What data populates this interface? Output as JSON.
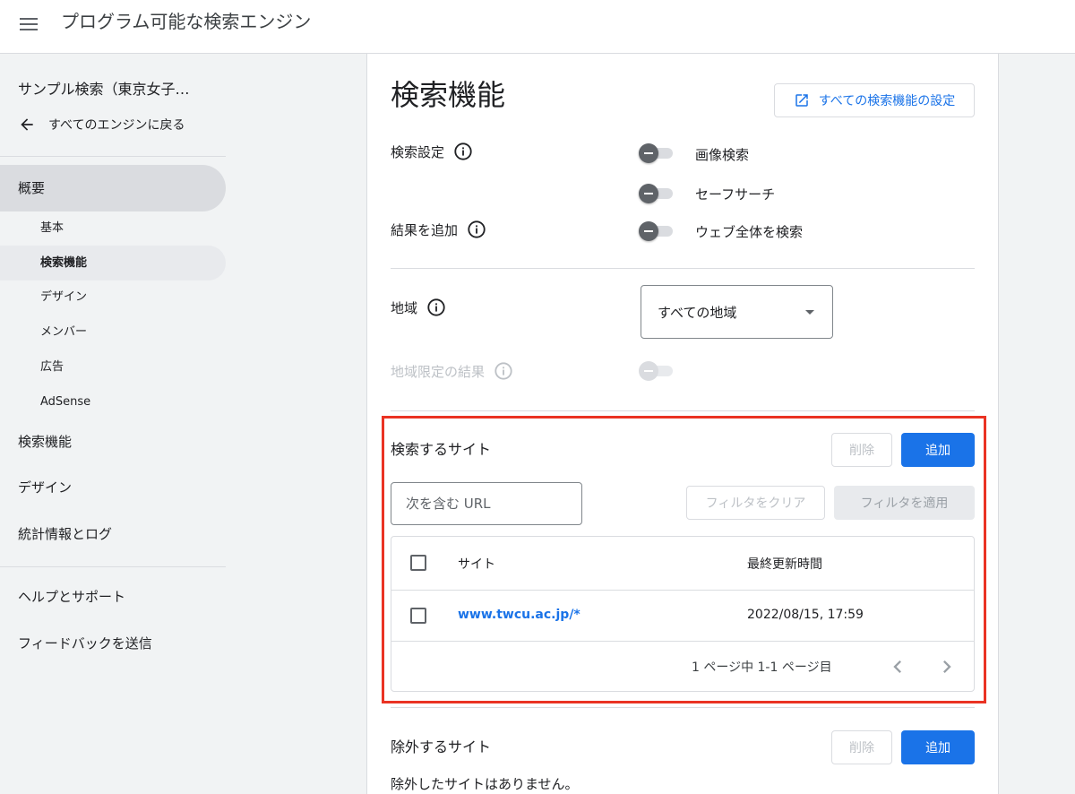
{
  "app": {
    "title": "プログラム可能な検索エンジン"
  },
  "sidebar": {
    "engine_name": "サンプル検索（東京女子…",
    "back_label": "すべてのエンジンに戻る",
    "overview": "概要",
    "sub_items": [
      "基本",
      "検索機能",
      "デザイン",
      "メンバー",
      "広告",
      "AdSense"
    ],
    "items": [
      "検索機能",
      "デザイン",
      "統計情報とログ"
    ],
    "help": "ヘルプとサポート",
    "feedback": "フィードバックを送信"
  },
  "main": {
    "title": "検索機能",
    "all_settings_button": "すべての検索機能の設定",
    "search_settings_label": "検索設定",
    "add_results_label": "結果を追加",
    "toggles": {
      "image_search": "画像検索",
      "safe_search": "セーフサーチ",
      "search_entire_web": "ウェブ全体を検索"
    },
    "region_label": "地域",
    "region_value": "すべての地域",
    "region_results_label": "地域限定の結果",
    "sites_to_search": {
      "title": "検索するサイト",
      "delete_button": "削除",
      "add_button": "追加",
      "filter_placeholder": "次を含む URL",
      "clear_filter_button": "フィルタをクリア",
      "apply_filter_button": "フィルタを適用",
      "columns": {
        "site": "サイト",
        "last_updated": "最終更新時間"
      },
      "rows": [
        {
          "site": "www.twcu.ac.jp/*",
          "last_updated": "2022/08/15, 17:59"
        }
      ],
      "pager": "1 ページ中 1-1 ページ目"
    },
    "sites_to_exclude": {
      "title": "除外するサイト",
      "delete_button": "削除",
      "add_button": "追加",
      "empty": "除外したサイトはありません。"
    }
  },
  "colors": {
    "accent": "#1a73e8",
    "highlight": "#ea3323",
    "sidebar_bg": "#f1f3f4"
  }
}
